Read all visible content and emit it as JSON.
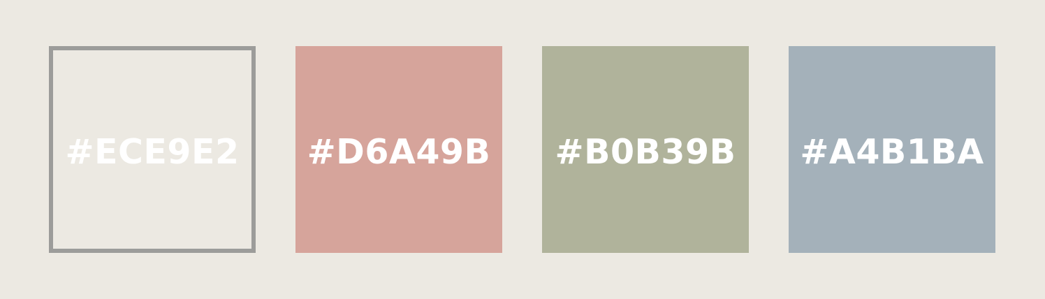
{
  "background_color": "#ECE9E2",
  "outline_color": "#9C9C9A",
  "label_color": "#FFFFFF",
  "swatches": [
    {
      "label": "#ECE9E2",
      "color": "#ECE9E2",
      "outlined": true
    },
    {
      "label": "#D6A49B",
      "color": "#D6A49B",
      "outlined": false
    },
    {
      "label": "#B0B39B",
      "color": "#B0B39B",
      "outlined": false
    },
    {
      "label": "#A4B1BA",
      "color": "#A4B1BA",
      "outlined": false
    }
  ]
}
